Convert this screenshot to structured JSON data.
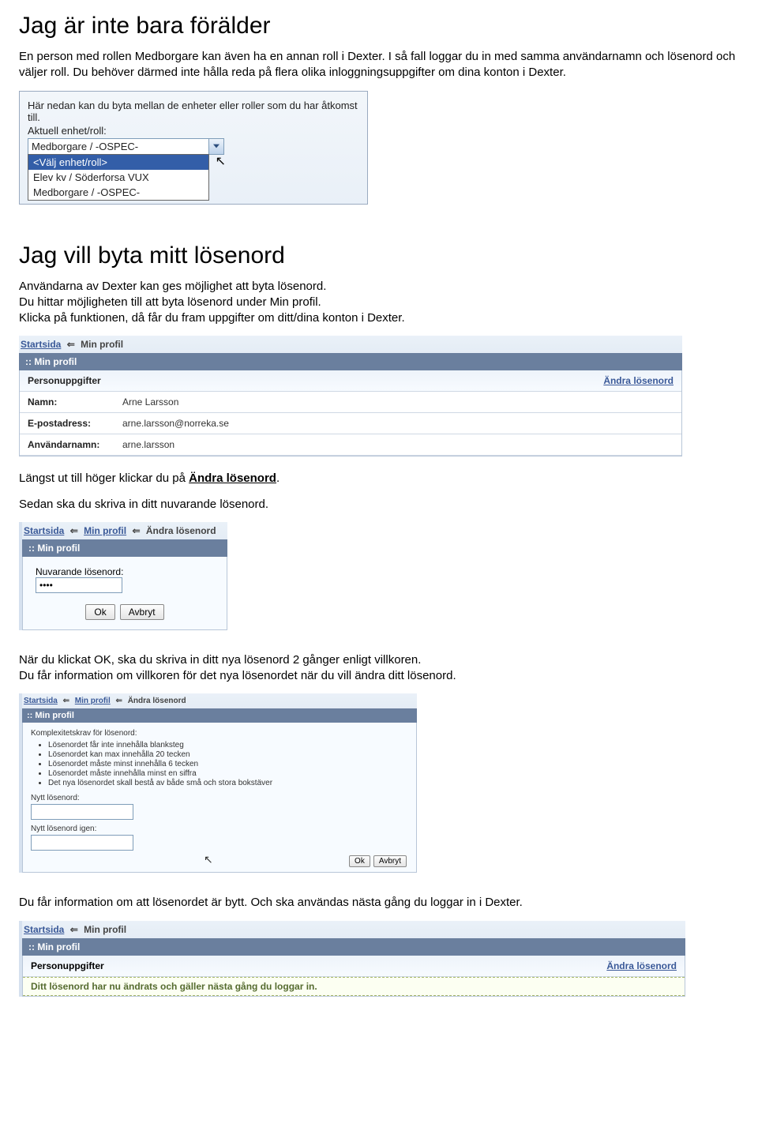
{
  "section1": {
    "heading": "Jag är inte bara förälder",
    "para": "En person med rollen Medborgare kan även ha en annan roll i Dexter. I så fall loggar du in med samma användarnamn och lösenord och väljer roll. Du behöver därmed inte hålla reda på flera olika inloggningsuppgifter om dina konton i Dexter."
  },
  "shot1": {
    "line1": "Här nedan kan du byta mellan de enheter eller roller som du har åtkomst till.",
    "label": "Aktuell enhet/roll:",
    "selected": "Medborgare / -OSPEC-",
    "options": [
      "<Välj enhet/roll>",
      "Elev kv / Söderforsa VUX",
      "Medborgare / -OSPEC-"
    ]
  },
  "section2": {
    "heading": "Jag vill byta mitt lösenord",
    "p1": "Användarna av Dexter kan ges möjlighet att byta lösenord.",
    "p2": "Du hittar möjligheten till att byta lösenord under Min profil.",
    "p3": "Klicka på funktionen, då får du fram uppgifter om ditt/dina konton i Dexter."
  },
  "shot2": {
    "bc_start": "Startsida",
    "bc_sep": "⇐",
    "bc_cur": "Min profil",
    "panel": ":: Min profil",
    "persons_label": "Personuppgifter",
    "change_link": "Ändra lösenord",
    "name_label": "Namn:",
    "name_val": "Arne Larsson",
    "email_label": "E-postadress:",
    "email_val": "arne.larsson@norreka.se",
    "user_label": "Användarnamn:",
    "user_val": "arne.larsson"
  },
  "section3": {
    "p1a": "Längst ut till höger klickar du på ",
    "p1b": "Ändra lösenord",
    "p1c": ".",
    "p2": "Sedan ska du skriva in ditt nuvarande lösenord."
  },
  "shot3": {
    "bc_start": "Startsida",
    "bc_mid": "Min profil",
    "bc_cur": "Ändra lösenord",
    "panel": ":: Min profil",
    "label": "Nuvarande lösenord:",
    "value": "••••",
    "ok": "Ok",
    "cancel": "Avbryt"
  },
  "section4": {
    "p1": "När du klickat OK, ska du skriva in ditt nya lösenord 2 gånger enligt villkoren.",
    "p2": "Du får information om villkoren för det nya lösenordet när du vill ändra ditt lösenord."
  },
  "shot4": {
    "bc_start": "Startsida",
    "bc_mid": "Min profil",
    "bc_cur": "Ändra lösenord",
    "panel": ":: Min profil",
    "rules_label": "Komplexitetskrav för lösenord:",
    "rules": [
      "Lösenordet får inte innehålla blanksteg",
      "Lösenordet kan max innehålla 20 tecken",
      "Lösenordet måste minst innehålla 6 tecken",
      "Lösenordet måste innehålla minst en siffra",
      "Det nya lösenordet skall bestå av både små och stora bokstäver"
    ],
    "new_label": "Nytt lösenord:",
    "again_label": "Nytt lösenord igen:",
    "ok": "Ok",
    "cancel": "Avbryt"
  },
  "section5": {
    "p": "Du får information om att lösenordet är bytt. Och ska användas nästa gång du loggar in i Dexter."
  },
  "shot5": {
    "bc_start": "Startsida",
    "bc_mid": "Min profil",
    "panel": ":: Min profil",
    "persons_label": "Personuppgifter",
    "change_link": "Ändra lösenord",
    "msg": "Ditt lösenord har nu ändrats och gäller nästa gång du loggar in."
  }
}
